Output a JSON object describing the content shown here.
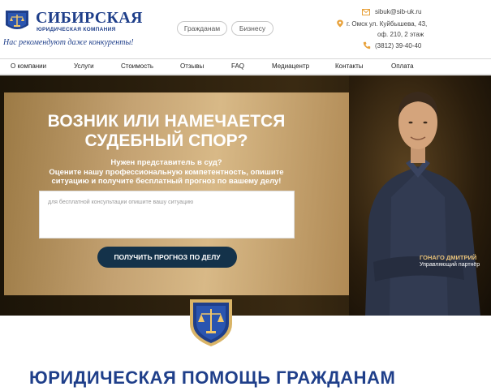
{
  "logo": {
    "main": "СИБИРСКАЯ",
    "sub": "ЮРИДИЧЕСКАЯ КОМПАНИЯ",
    "tagline": "Нас рекомендуют даже конкуренты!"
  },
  "header": {
    "pills": {
      "citizens": "Гражданам",
      "business": "Бизнесу"
    },
    "contacts": {
      "email": "sibuk@sib-uk.ru",
      "address_line1": "г. Омск ул. Куйбышева, 43,",
      "address_line2": "оф. 210, 2 этаж",
      "phone": "(3812) 39-40-40"
    }
  },
  "nav": {
    "items": [
      "О компании",
      "Услуги",
      "Стоимость",
      "Отзывы",
      "FAQ",
      "Медиацентр",
      "Контакты",
      "Оплата"
    ]
  },
  "hero": {
    "title_line1": "ВОЗНИК ИЛИ НАМЕЧАЕТСЯ",
    "title_line2": "СУДЕБНЫЙ СПОР?",
    "question": "Нужен представитель в суд?",
    "desc_line1": "Оцените нашу профессиональную компетентность, опишите",
    "desc_line2": "ситуацию и получите бесплатный прогноз по вашему делу!",
    "textarea_placeholder": "для бесплатной консультации опишите вашу ситуацию",
    "button": "ПОЛУЧИТЬ ПРОГНОЗ ПО ДЕЛУ",
    "person_name": "ГОНАГО ДМИТРИЙ",
    "person_role": "Управляющий партнёр"
  },
  "section": {
    "title": "ЮРИДИЧЕСКАЯ ПОМОЩЬ ГРАЖДАНАМ"
  },
  "colors": {
    "brand_blue": "#1f3f8a",
    "button_navy": "#14324a",
    "gold": "#c4a272",
    "accent_orange": "#e8a13a"
  },
  "icons": {
    "email": "envelope-icon",
    "address": "location-pin-icon",
    "phone": "phone-icon",
    "logo": "scales-emblem-icon",
    "shield": "shield-emblem-icon"
  }
}
